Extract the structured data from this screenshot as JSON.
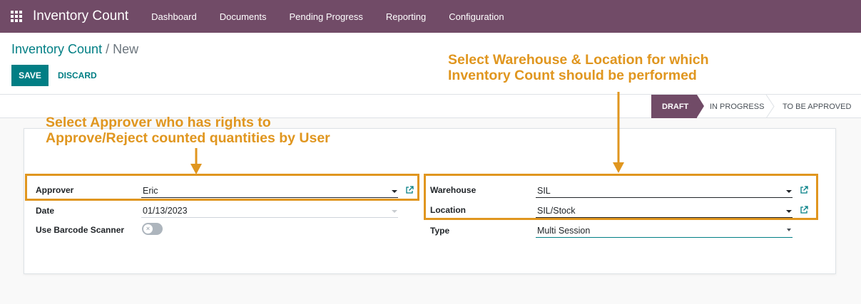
{
  "navbar": {
    "app_title": "Inventory Count",
    "menu": [
      "Dashboard",
      "Documents",
      "Pending Progress",
      "Reporting",
      "Configuration"
    ]
  },
  "breadcrumb": {
    "parent": "Inventory Count",
    "separator": "/",
    "current": "New"
  },
  "buttons": {
    "save": "SAVE",
    "discard": "DISCARD"
  },
  "statusbar": {
    "stages": [
      "DRAFT",
      "IN PROGRESS",
      "TO BE APPROVED"
    ],
    "active": "DRAFT"
  },
  "form": {
    "approver": {
      "label": "Approver",
      "value": "Eric"
    },
    "date": {
      "label": "Date",
      "value": "01/13/2023"
    },
    "barcode": {
      "label": "Use Barcode Scanner",
      "enabled": false
    },
    "warehouse": {
      "label": "Warehouse",
      "value": "SIL"
    },
    "location": {
      "label": "Location",
      "value": "SIL/Stock"
    },
    "type": {
      "label": "Type",
      "value": "Multi Session"
    }
  },
  "annotations": {
    "warehouse_location": [
      "Select Warehouse & Location for which",
      "Inventory Count should be performed"
    ],
    "approver": [
      "Select Approver who has rights to",
      "Approve/Reject counted quantities by User"
    ]
  },
  "colors": {
    "navbar": "#714b67",
    "primary": "#017e84",
    "annotation": "#e0961f"
  }
}
